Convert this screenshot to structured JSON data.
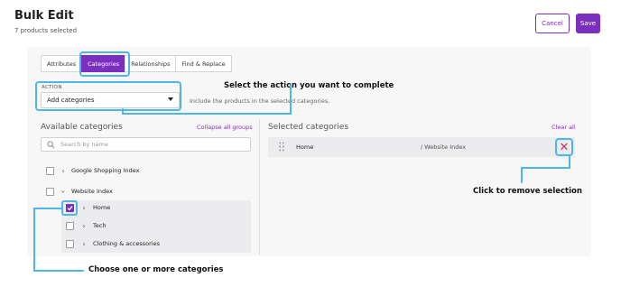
{
  "header": {
    "title": "Bulk Edit",
    "subtitle": "7 products selected",
    "cancel_label": "Cancel",
    "save_label": "Save"
  },
  "tabs": [
    {
      "label": "Attributes",
      "active": false
    },
    {
      "label": "Categories",
      "active": true
    },
    {
      "label": "Relationships",
      "active": false
    },
    {
      "label": "Find & Replace",
      "active": false
    }
  ],
  "action": {
    "label": "ACTION",
    "selected": "Add categories",
    "help_text": "Include the products in the selected categories."
  },
  "available": {
    "title": "Available categories",
    "collapse_label": "Collapse all groups",
    "search_placeholder": "Search by name",
    "items": [
      {
        "label": "Google Shopping Index",
        "checked": false,
        "expanded": false
      },
      {
        "label": "Website Index",
        "checked": false,
        "expanded": true
      },
      {
        "label": "Home",
        "checked": true,
        "expanded": false
      },
      {
        "label": "Tech",
        "checked": false,
        "expanded": false
      },
      {
        "label": "Clothing & accessories",
        "checked": false,
        "expanded": false
      }
    ]
  },
  "selected": {
    "title": "Selected categories",
    "clear_label": "Clear all",
    "items": [
      {
        "name": "Home",
        "path": "/ Website Index"
      }
    ]
  },
  "callouts": {
    "action": "Select the action you want to complete",
    "remove": "Click to remove selection",
    "choose": "Choose one or more categories"
  },
  "colors": {
    "accent": "#7b2fbf",
    "highlight": "#4db8e8",
    "remove": "#c0306a"
  }
}
